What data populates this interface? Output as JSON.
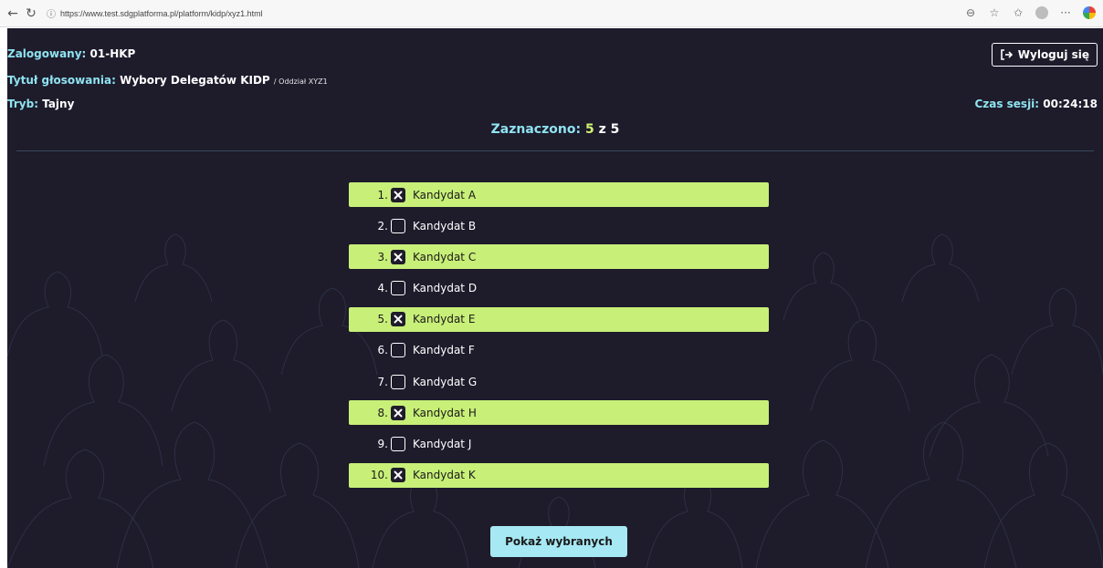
{
  "browser": {
    "url": "https://www.test.sdgplatforma.pl/platform/kidp/xyz1.html"
  },
  "header": {
    "logged_label": "Zalogowany:",
    "logged_value": "01-HKP",
    "title_label": "Tytuł głosowania:",
    "title_value": "Wybory Delegatów KIDP",
    "title_suffix": "/ Oddział XYZ1",
    "mode_label": "Tryb:",
    "mode_value": "Tajny",
    "logout_label": "Wyloguj się",
    "session_label": "Czas sesji:",
    "session_value": "00:24:18"
  },
  "counter": {
    "label": "Zaznaczono:",
    "selected": "5",
    "separator": "z",
    "total": "5"
  },
  "candidates": [
    {
      "num": "1.",
      "name": "Kandydat A",
      "selected": true
    },
    {
      "num": "2.",
      "name": "Kandydat B",
      "selected": false
    },
    {
      "num": "3.",
      "name": "Kandydat C",
      "selected": true
    },
    {
      "num": "4.",
      "name": "Kandydat D",
      "selected": false
    },
    {
      "num": "5.",
      "name": "Kandydat E",
      "selected": true
    },
    {
      "num": "6.",
      "name": "Kandydat F",
      "selected": false
    },
    {
      "num": "7.",
      "name": "Kandydat G",
      "selected": false
    },
    {
      "num": "8.",
      "name": "Kandydat H",
      "selected": true
    },
    {
      "num": "9.",
      "name": "Kandydat J",
      "selected": false
    },
    {
      "num": "10.",
      "name": "Kandydat K",
      "selected": true
    }
  ],
  "show_button": "Pokaż wybranych",
  "colors": {
    "background": "#1e1b2b",
    "accent_label": "#8fe3f0",
    "selected_row": "#c8ef78",
    "button": "#a6e8f4"
  }
}
